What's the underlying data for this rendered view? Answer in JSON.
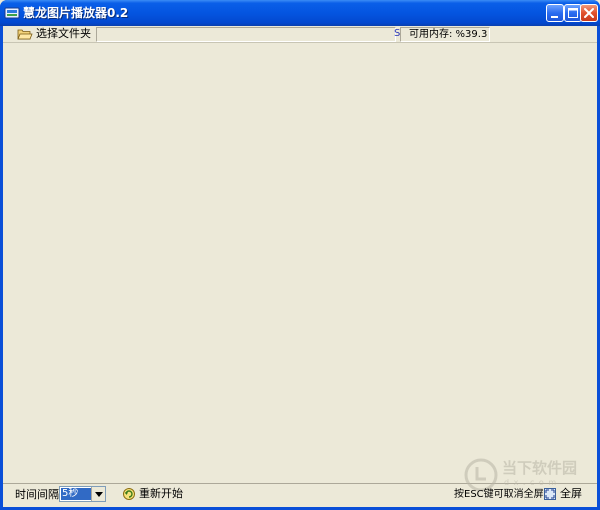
{
  "window": {
    "title": "慧龙图片播放器0.2",
    "icon": "app-icon",
    "title_color": "#ffffff",
    "titlebar_color": "#0455e0"
  },
  "toolbar": {
    "folder_button_label": "选择文件夹",
    "folder_icon": "open-folder-icon",
    "small_glyph": "S",
    "memory_label": "可用内存: %39.3"
  },
  "statusbar": {
    "interval_label": "时间间隔:",
    "interval_value": "5秒",
    "restart_label": "重新开始",
    "restart_icon": "restart-icon",
    "esc_hint": "按ESC键可取消全屏",
    "fullscreen_label": "全屏",
    "fullscreen_icon": "fullscreen-icon"
  },
  "watermark": {
    "text": "当下软件园",
    "sub": "d x . c o m",
    "logo": "watermark-logo-icon"
  },
  "colors": {
    "background": "#ece9d8",
    "selection": "#316ac5"
  }
}
